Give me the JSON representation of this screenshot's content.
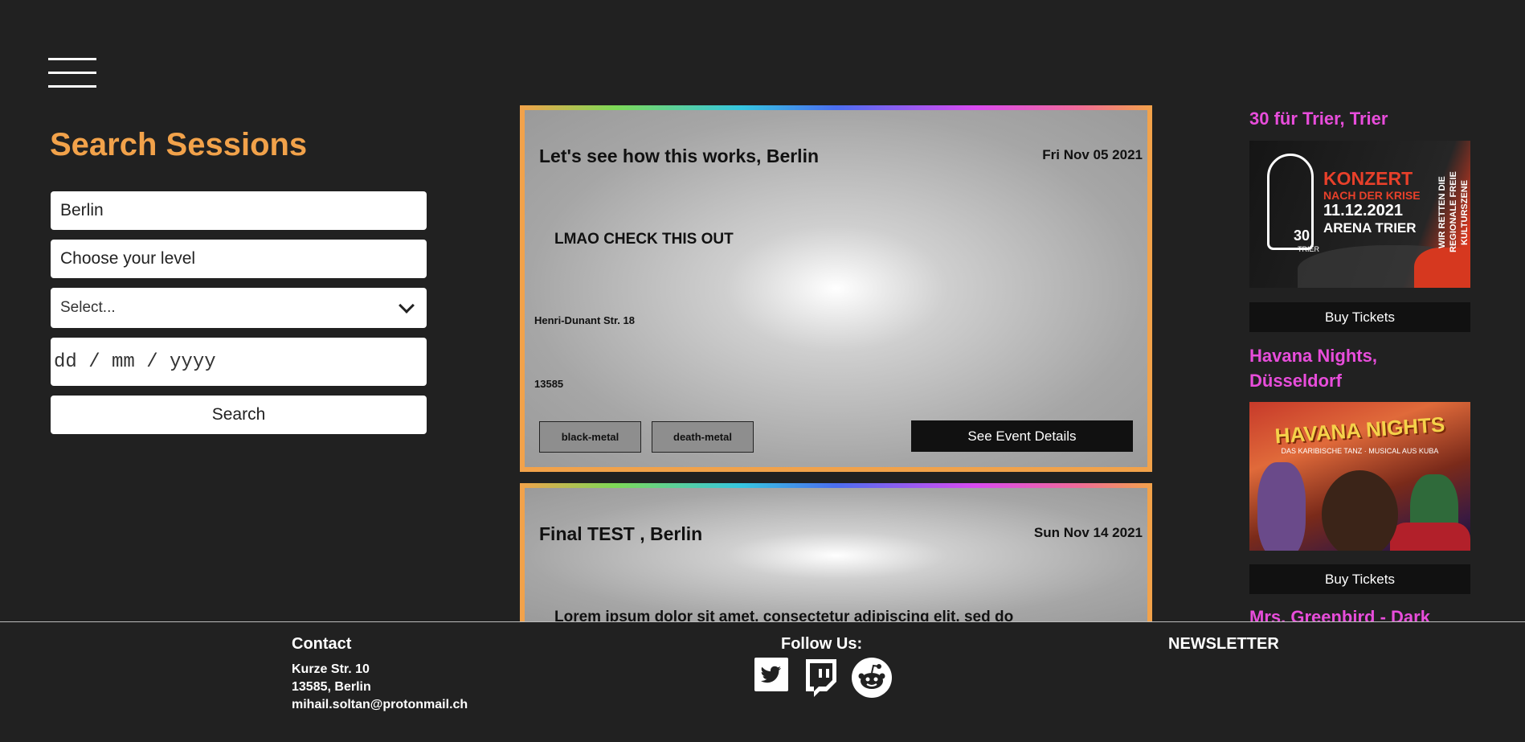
{
  "search": {
    "title": "Search Sessions",
    "city_value": "Berlin",
    "level_placeholder": "Choose your level",
    "select_value": "Select...",
    "date_placeholder": "dd / mm / yyyy",
    "button_label": "Search"
  },
  "events": [
    {
      "title": "Let's see how this works, Berlin",
      "date": "Fri Nov 05 2021",
      "description": "LMAO CHECK THIS OUT",
      "street": "Henri-Dunant Str. 18",
      "zip": "13585",
      "tags": [
        "black-metal",
        "death-metal"
      ],
      "details_label": "See Event Details"
    },
    {
      "title": "Final TEST , Berlin",
      "date": "Sun Nov 14 2021",
      "description": "Lorem ipsum dolor sit amet, consectetur adipiscing elit, sed do"
    }
  ],
  "featured": [
    {
      "title": "30 für Trier, Trier",
      "buy_label": "Buy Tickets",
      "poster": {
        "line1": "KONZERT",
        "line2": "NACH DER KRISE",
        "date": "11.12.2021",
        "venue": "ARENA TRIER",
        "side": "WIR RETTEN DIE REGIONALE FREIE KULTURSZENE",
        "logo_number": "30",
        "logo_city": "TRIER"
      }
    },
    {
      "title": "Havana Nights, Düsseldorf",
      "buy_label": "Buy Tickets",
      "poster": {
        "title": "HAVANA NIGHTS",
        "sub": "DAS KARIBISCHE TANZ · MUSICAL AUS KUBA"
      }
    },
    {
      "title": "Mrs. Greenbird - Dark"
    }
  ],
  "footer": {
    "contact_title": "Contact",
    "street": "Kurze Str. 10",
    "city": "13585, Berlin",
    "email": "mihail.soltan@protonmail.ch",
    "follow_title": "Follow Us:",
    "newsletter_title": "NEWSLETTER"
  },
  "colors": {
    "accent": "#f2a24a",
    "featured_title": "#e84ddb",
    "background": "#212121"
  },
  "icons": [
    "hamburger-menu-icon",
    "chevron-down-icon",
    "twitter-icon",
    "twitch-icon",
    "reddit-icon"
  ]
}
